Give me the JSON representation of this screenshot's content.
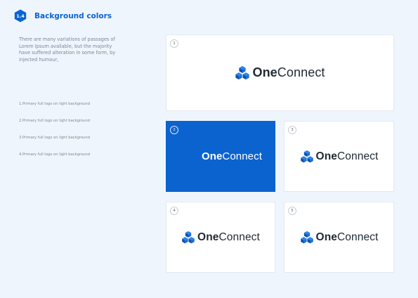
{
  "header": {
    "section_number": "1.4",
    "title": "Background colors"
  },
  "description": "There are many variations of passages of Lorem Ipsum available, but the majority have suffered alteration in some form, by injected humour,",
  "list": [
    "1.Primary full logo on light background",
    "2.Primary full logo on light background",
    "3.Primary full logo on light background",
    "4.Primary full logo on light background"
  ],
  "logo": {
    "word_bold": "One",
    "word_regular": "Connect"
  },
  "panels": [
    {
      "number": "1",
      "background": "#ffffff",
      "show_mark": true
    },
    {
      "number": "2",
      "background": "#0b63cf",
      "show_mark": false
    },
    {
      "number": "3",
      "background": "#ffffff",
      "show_mark": true
    },
    {
      "number": "4",
      "background": "#ffffff",
      "show_mark": true
    },
    {
      "number": "5",
      "background": "#ffffff",
      "show_mark": true
    }
  ],
  "colors": {
    "brand_blue": "#0b63cf",
    "page_background": "#eef5fd",
    "mark_dark": "#0a4fb0",
    "mark_light": "#2e86e8"
  }
}
